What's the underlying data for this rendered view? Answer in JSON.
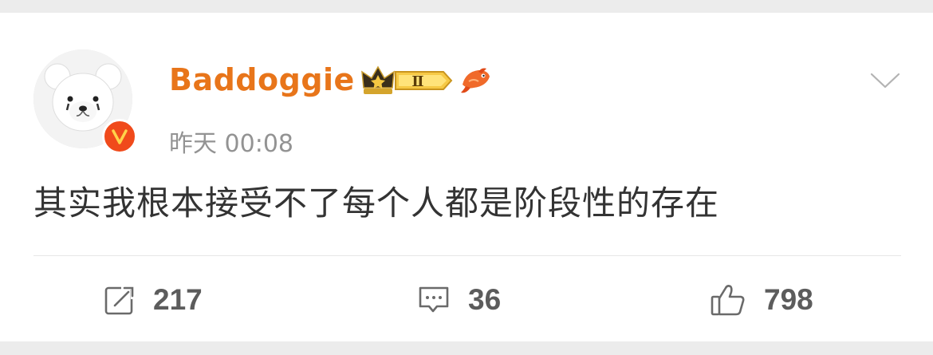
{
  "post": {
    "username": "Baddoggie",
    "member_level": "Ⅱ",
    "timestamp": "昨天 00:08",
    "content": "其实我根本接受不了每个人都是阶段性的存在",
    "verified_badge": "V"
  },
  "actions": {
    "repost_count": "217",
    "comment_count": "36",
    "like_count": "798"
  },
  "colors": {
    "username": "#e8751a",
    "verified": "#f04a1b",
    "text": "#333333",
    "meta": "#939393"
  }
}
